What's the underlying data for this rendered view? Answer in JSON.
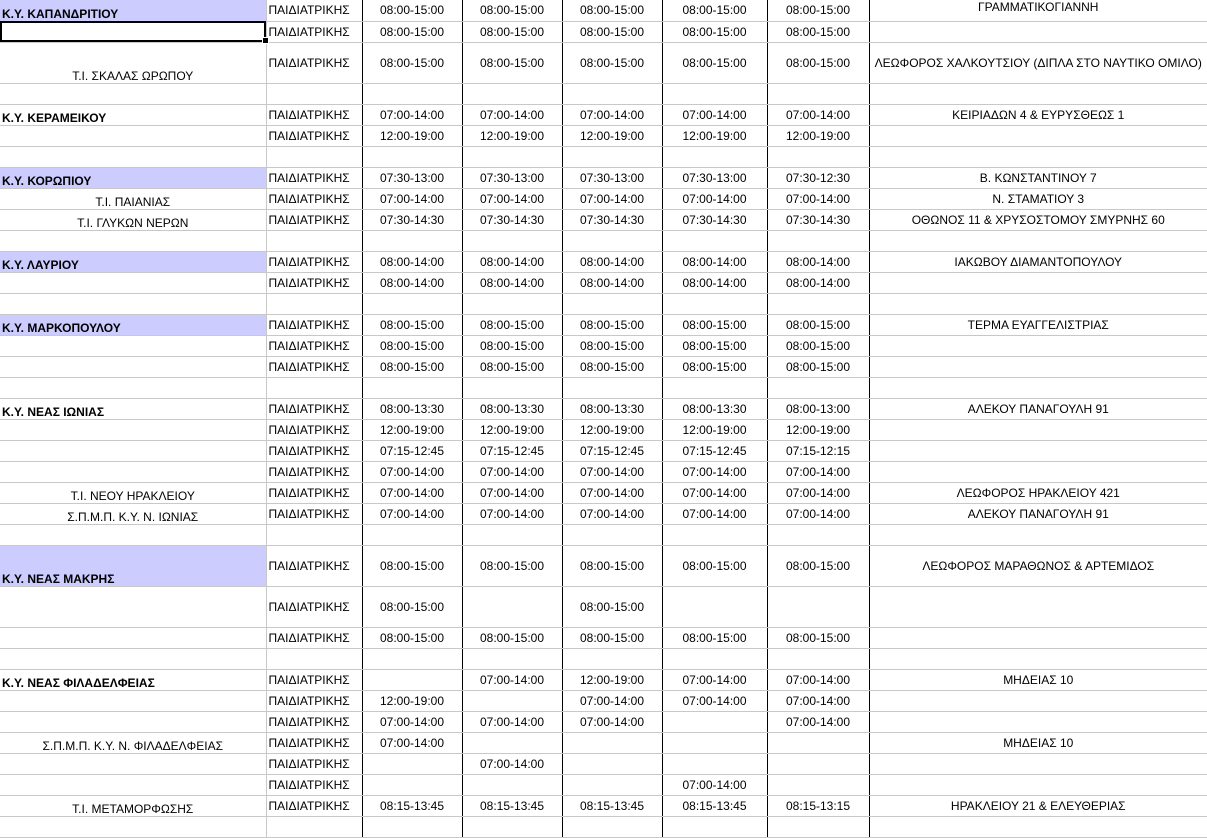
{
  "rows": [
    {
      "label": "Κ.Υ. ΚΑΠΑΝΔΡΙΤΙΟΥ",
      "label_style": "hl",
      "specialty": "ΠΑΙΔΙΑΤΡΙΚΗΣ",
      "times": [
        "08:00-15:00",
        "08:00-15:00",
        "08:00-15:00",
        "08:00-15:00",
        "08:00-15:00"
      ],
      "address": "ΓΡΑΜΜΑΤΙΚΟΓΙΑΝΝΗ",
      "address_align": "top"
    },
    {
      "label": "",
      "label_style": "sel",
      "specialty": "ΠΑΙΔΙΑΤΡΙΚΗΣ",
      "times": [
        "08:00-15:00",
        "08:00-15:00",
        "08:00-15:00",
        "08:00-15:00",
        "08:00-15:00"
      ],
      "address": ""
    },
    {
      "label": "Τ.Ι. ΣΚΑΛΑΣ ΩΡΩΠΟΥ",
      "label_style": "",
      "specialty": "ΠΑΙΔΙΑΤΡΙΚΗΣ",
      "times": [
        "08:00-15:00",
        "08:00-15:00",
        "08:00-15:00",
        "08:00-15:00",
        "08:00-15:00"
      ],
      "address": "ΛΕΩΦΟΡΟΣ ΧΑΛΚΟΥΤΣΙΟΥ (ΔΙΠΛΑ ΣΤΟ ΝΑΥΤΙΚΟ ΟΜΙΛΟ)",
      "tall": true
    },
    {
      "blank": true
    },
    {
      "label": "Κ.Υ. ΚΕΡΑΜΕΙΚΟΥ",
      "label_style": "bold",
      "specialty": "ΠΑΙΔΙΑΤΡΙΚΗΣ",
      "times": [
        "07:00-14:00",
        "07:00-14:00",
        "07:00-14:00",
        "07:00-14:00",
        "07:00-14:00"
      ],
      "address": "ΚΕΙΡΙΑΔΩΝ 4 & ΕΥΡΥΣΘΕΩΣ 1"
    },
    {
      "label": "",
      "label_style": "",
      "specialty": "ΠΑΙΔΙΑΤΡΙΚΗΣ",
      "times": [
        "12:00-19:00",
        "12:00-19:00",
        "12:00-19:00",
        "12:00-19:00",
        "12:00-19:00"
      ],
      "address": ""
    },
    {
      "blank": true
    },
    {
      "label": "Κ.Υ. ΚΟΡΩΠΙΟΥ",
      "label_style": "hl",
      "specialty": "ΠΑΙΔΙΑΤΡΙΚΗΣ",
      "times": [
        "07:30-13:00",
        "07:30-13:00",
        "07:30-13:00",
        "07:30-13:00",
        "07:30-12:30"
      ],
      "address": "Β. ΚΩΝΣΤΑΝΤΙΝΟΥ 7"
    },
    {
      "label": "Τ.Ι. ΠΑΙΑΝΙΑΣ",
      "label_style": "",
      "specialty": "ΠΑΙΔΙΑΤΡΙΚΗΣ",
      "times": [
        "07:00-14:00",
        "07:00-14:00",
        "07:00-14:00",
        "07:00-14:00",
        "07:00-14:00"
      ],
      "address": "Ν. ΣΤΑΜΑΤΙΟΥ 3"
    },
    {
      "label": "Τ.Ι. ΓΛΥΚΩΝ ΝΕΡΩΝ",
      "label_style": "",
      "specialty": "ΠΑΙΔΙΑΤΡΙΚΗΣ",
      "times": [
        "07:30-14:30",
        "07:30-14:30",
        "07:30-14:30",
        "07:30-14:30",
        "07:30-14:30"
      ],
      "address": "ΟΘΩΝΟΣ 11 & ΧΡΥΣΟΣΤΟΜΟΥ ΣΜΥΡΝΗΣ 60"
    },
    {
      "blank": true
    },
    {
      "label": "Κ.Υ. ΛΑΥΡΙΟΥ",
      "label_style": "hl",
      "specialty": "ΠΑΙΔΙΑΤΡΙΚΗΣ",
      "times": [
        "08:00-14:00",
        "08:00-14:00",
        "08:00-14:00",
        "08:00-14:00",
        "08:00-14:00"
      ],
      "address": "ΙΑΚΩΒΟΥ ΔΙΑΜΑΝΤΟΠΟΥΛΟΥ"
    },
    {
      "label": "",
      "label_style": "",
      "specialty": "ΠΑΙΔΙΑΤΡΙΚΗΣ",
      "times": [
        "08:00-14:00",
        "08:00-14:00",
        "08:00-14:00",
        "08:00-14:00",
        "08:00-14:00"
      ],
      "address": ""
    },
    {
      "blank": true
    },
    {
      "label": "Κ.Υ. ΜΑΡΚΟΠΟΥΛΟΥ",
      "label_style": "hl",
      "specialty": "ΠΑΙΔΙΑΤΡΙΚΗΣ",
      "times": [
        "08:00-15:00",
        "08:00-15:00",
        "08:00-15:00",
        "08:00-15:00",
        "08:00-15:00"
      ],
      "address": "ΤΕΡΜΑ ΕΥΑΓΓΕΛΙΣΤΡΙΑΣ"
    },
    {
      "label": "",
      "label_style": "",
      "specialty": "ΠΑΙΔΙΑΤΡΙΚΗΣ",
      "times": [
        "08:00-15:00",
        "08:00-15:00",
        "08:00-15:00",
        "08:00-15:00",
        "08:00-15:00"
      ],
      "address": ""
    },
    {
      "label": "",
      "label_style": "",
      "specialty": "ΠΑΙΔΙΑΤΡΙΚΗΣ",
      "times": [
        "08:00-15:00",
        "08:00-15:00",
        "08:00-15:00",
        "08:00-15:00",
        "08:00-15:00"
      ],
      "address": ""
    },
    {
      "blank": true
    },
    {
      "label": "Κ.Υ. ΝΕΑΣ ΙΩΝΙΑΣ",
      "label_style": "bold",
      "specialty": "ΠΑΙΔΙΑΤΡΙΚΗΣ",
      "times": [
        "08:00-13:30",
        "08:00-13:30",
        "08:00-13:30",
        "08:00-13:30",
        "08:00-13:00"
      ],
      "address": "ΑΛΕΚΟΥ ΠΑΝΑΓΟΥΛΗ 91"
    },
    {
      "label": "",
      "label_style": "",
      "specialty": "ΠΑΙΔΙΑΤΡΙΚΗΣ",
      "times": [
        "12:00-19:00",
        "12:00-19:00",
        "12:00-19:00",
        "12:00-19:00",
        "12:00-19:00"
      ],
      "address": ""
    },
    {
      "label": "",
      "label_style": "",
      "specialty": "ΠΑΙΔΙΑΤΡΙΚΗΣ",
      "times": [
        "07:15-12:45",
        "07:15-12:45",
        "07:15-12:45",
        "07:15-12:45",
        "07:15-12:15"
      ],
      "address": ""
    },
    {
      "label": "",
      "label_style": "",
      "specialty": "ΠΑΙΔΙΑΤΡΙΚΗΣ",
      "times": [
        "07:00-14:00",
        "07:00-14:00",
        "07:00-14:00",
        "07:00-14:00",
        "07:00-14:00"
      ],
      "address": ""
    },
    {
      "label": "Τ.Ι. ΝΕΟΥ ΗΡΑΚΛΕΙΟΥ",
      "label_style": "",
      "specialty": "ΠΑΙΔΙΑΤΡΙΚΗΣ",
      "times": [
        "07:00-14:00",
        "07:00-14:00",
        "07:00-14:00",
        "07:00-14:00",
        "07:00-14:00"
      ],
      "address": "ΛΕΩΦΟΡΟΣ ΗΡΑΚΛΕΙΟΥ 421"
    },
    {
      "label": "Σ.Π.Μ.Π. Κ.Υ. Ν. ΙΩΝΙΑΣ",
      "label_style": "",
      "specialty": "ΠΑΙΔΙΑΤΡΙΚΗΣ",
      "times": [
        "07:00-14:00",
        "07:00-14:00",
        "07:00-14:00",
        "07:00-14:00",
        "07:00-14:00"
      ],
      "address": "ΑΛΕΚΟΥ ΠΑΝΑΓΟΥΛΗ 91"
    },
    {
      "blank": true
    },
    {
      "label": "Κ.Υ. ΝΕΑΣ ΜΑΚΡΗΣ",
      "label_style": "hl",
      "specialty": "ΠΑΙΔΙΑΤΡΙΚΗΣ",
      "times": [
        "08:00-15:00",
        "08:00-15:00",
        "08:00-15:00",
        "08:00-15:00",
        "08:00-15:00"
      ],
      "address": "ΛΕΩΦΟΡΟΣ ΜΑΡΑΘΩΝΟΣ & ΑΡΤΕΜΙΔΟΣ",
      "tall": true
    },
    {
      "label": "",
      "label_style": "",
      "specialty": "ΠΑΙΔΙΑΤΡΙΚΗΣ",
      "times": [
        "08:00-15:00",
        "",
        "08:00-15:00",
        "",
        ""
      ],
      "address": "",
      "tall": true
    },
    {
      "label": "",
      "label_style": "",
      "specialty": "ΠΑΙΔΙΑΤΡΙΚΗΣ",
      "times": [
        "08:00-15:00",
        "08:00-15:00",
        "08:00-15:00",
        "08:00-15:00",
        "08:00-15:00"
      ],
      "address": ""
    },
    {
      "blank": true
    },
    {
      "label": "Κ.Υ. ΝΕΑΣ ΦΙΛΑΔΕΛΦΕΙΑΣ",
      "label_style": "bold",
      "specialty": "ΠΑΙΔΙΑΤΡΙΚΗΣ",
      "times": [
        "",
        "07:00-14:00",
        "12:00-19:00",
        "07:00-14:00",
        "07:00-14:00"
      ],
      "address": "ΜΗΔΕΙΑΣ 10"
    },
    {
      "label": "",
      "label_style": "",
      "specialty": "ΠΑΙΔΙΑΤΡΙΚΗΣ",
      "times": [
        "12:00-19:00",
        "",
        "07:00-14:00",
        "07:00-14:00",
        "07:00-14:00"
      ],
      "address": ""
    },
    {
      "label": "",
      "label_style": "",
      "specialty": "ΠΑΙΔΙΑΤΡΙΚΗΣ",
      "times": [
        "07:00-14:00",
        "07:00-14:00",
        "07:00-14:00",
        "",
        "07:00-14:00"
      ],
      "address": ""
    },
    {
      "label": "Σ.Π.Μ.Π. Κ.Υ. Ν. ΦΙΛΑΔΕΛΦΕΙΑΣ",
      "label_style": "",
      "specialty": "ΠΑΙΔΙΑΤΡΙΚΗΣ",
      "times": [
        "07:00-14:00",
        "",
        "",
        "",
        ""
      ],
      "address": "ΜΗΔΕΙΑΣ 10"
    },
    {
      "label": "",
      "label_style": "",
      "specialty": "ΠΑΙΔΙΑΤΡΙΚΗΣ",
      "times": [
        "",
        "07:00-14:00",
        "",
        "",
        ""
      ],
      "address": ""
    },
    {
      "label": "",
      "label_style": "",
      "specialty": "ΠΑΙΔΙΑΤΡΙΚΗΣ",
      "times": [
        "",
        "",
        "",
        "07:00-14:00",
        ""
      ],
      "address": ""
    },
    {
      "label": "Τ.Ι. ΜΕΤΑΜΟΡΦΩΣΗΣ",
      "label_style": "",
      "specialty": "ΠΑΙΔΙΑΤΡΙΚΗΣ",
      "times": [
        "08:15-13:45",
        "08:15-13:45",
        "08:15-13:45",
        "08:15-13:45",
        "08:15-13:15"
      ],
      "address": "ΗΡΑΚΛΕΙΟΥ 21 & ΕΛΕΥΘΕΡΙΑΣ"
    },
    {
      "blank": true
    }
  ]
}
